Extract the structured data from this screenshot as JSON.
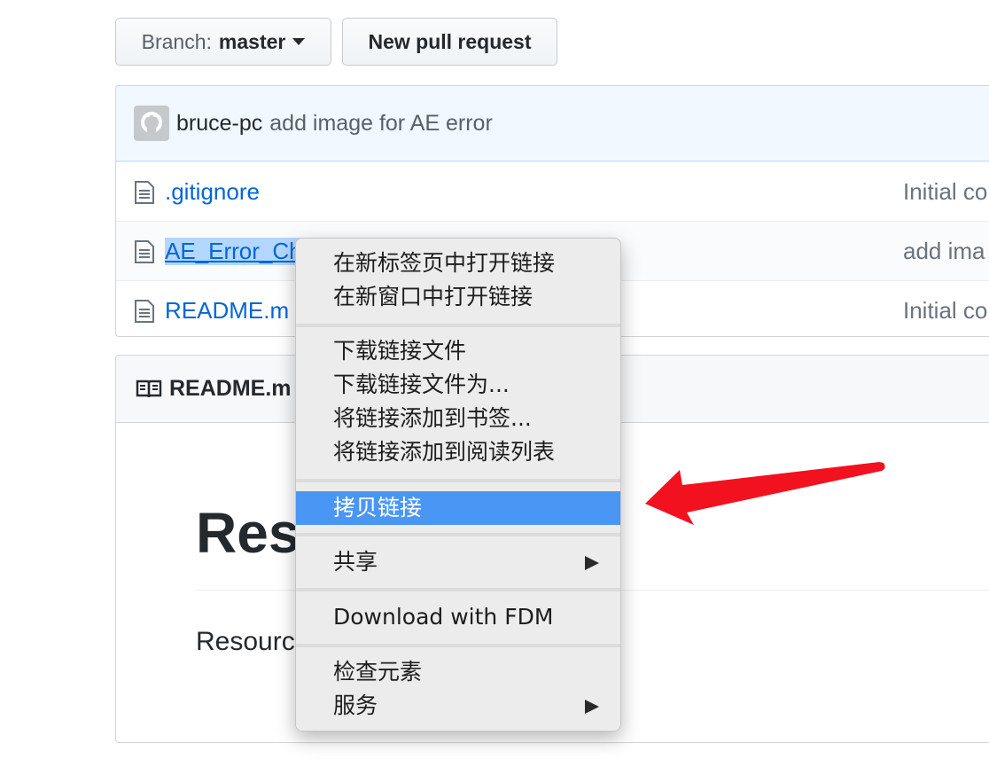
{
  "toolbar": {
    "branch_prefix": "Branch:",
    "branch_name": "master",
    "new_pr_label": "New pull request"
  },
  "latest_commit": {
    "author": "bruce-pc",
    "message": "add image for AE error"
  },
  "files": [
    {
      "name": ".gitignore",
      "commit": "Initial co"
    },
    {
      "name": "AE_Error_Ch",
      "commit": "add ima"
    },
    {
      "name": "README.m",
      "commit": "Initial co"
    }
  ],
  "readme": {
    "header": "README.m",
    "heading": "Reso",
    "paragraph": "Resourc"
  },
  "context_menu": {
    "items": [
      {
        "label": "在新标签页中打开链接"
      },
      {
        "label": "在新窗口中打开链接"
      },
      {
        "label": "下载链接文件"
      },
      {
        "label": "下载链接文件为..."
      },
      {
        "label": "将链接添加到书签..."
      },
      {
        "label": "将链接添加到阅读列表"
      },
      {
        "label": "拷贝链接",
        "highlighted": true
      },
      {
        "label": "共享",
        "submenu": true
      },
      {
        "label": "Download with FDM"
      },
      {
        "label": "检查元素"
      },
      {
        "label": "服务",
        "submenu": true
      }
    ]
  },
  "colors": {
    "link": "#0366d6",
    "menu_highlight": "#4a96f5",
    "annotation_arrow": "#f2111f"
  },
  "icons": [
    "caret-down-icon",
    "octocat-icon",
    "file-icon",
    "book-icon",
    "submenu-arrow-icon",
    "red-arrow-annotation"
  ]
}
